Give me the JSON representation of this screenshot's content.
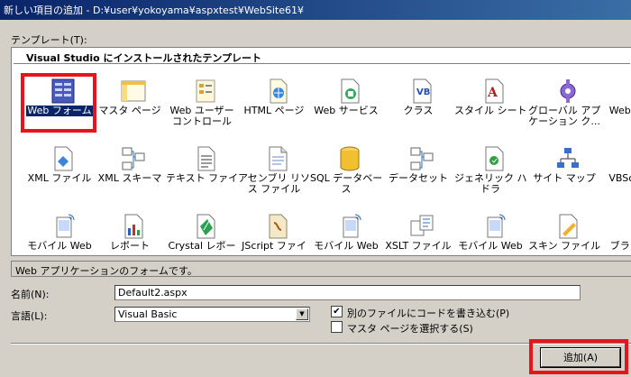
{
  "window": {
    "title": "新しい項目の追加 - D:¥user¥yokoyama¥aspxtest¥WebSite61¥"
  },
  "templates_label": "テンプレート(T):",
  "group_header": "Visual Studio にインストールされたテンプレート",
  "items": [
    {
      "l1": "Web フォーム",
      "l2": "",
      "icon": "web-form-icon"
    },
    {
      "l1": "マスタ ページ",
      "l2": "",
      "icon": "master-page-icon"
    },
    {
      "l1": "Web ユーザー",
      "l2": "コントロール",
      "icon": "web-user-control-icon"
    },
    {
      "l1": "HTML ページ",
      "l2": "",
      "icon": "html-page-icon"
    },
    {
      "l1": "Web サービス",
      "l2": "",
      "icon": "web-service-icon"
    },
    {
      "l1": "クラス",
      "l2": "",
      "icon": "class-icon"
    },
    {
      "l1": "スタイル シート",
      "l2": "",
      "icon": "style-sheet-icon"
    },
    {
      "l1": "グローバル アプリ",
      "l2": "ケーション ク...",
      "icon": "global-application-icon"
    },
    {
      "l1": "Web 構成フ",
      "l2": "ル",
      "icon": "web-config-icon"
    },
    {
      "l1": "XML ファイル",
      "l2": "",
      "icon": "xml-file-icon"
    },
    {
      "l1": "XML スキーマ",
      "l2": "",
      "icon": "xml-schema-icon"
    },
    {
      "l1": "テキスト ファイル",
      "l2": "",
      "icon": "text-file-icon"
    },
    {
      "l1": "アセンブリ リソー",
      "l2": "ス ファイル",
      "icon": "assembly-resource-icon"
    },
    {
      "l1": "SQL データベー",
      "l2": "ス",
      "icon": "sql-database-icon"
    },
    {
      "l1": "データセット",
      "l2": "",
      "icon": "dataset-icon"
    },
    {
      "l1": "ジェネリック ハン",
      "l2": "ドラ",
      "icon": "generic-handler-icon"
    },
    {
      "l1": "サイト マップ",
      "l2": "",
      "icon": "site-map-icon"
    },
    {
      "l1": "VBScript フ",
      "l2": "",
      "icon": "vbscript-file-icon"
    },
    {
      "l1": "モバイル Web",
      "l2": "",
      "icon": "mobile-web-form-icon"
    },
    {
      "l1": "レポート",
      "l2": "",
      "icon": "report-icon"
    },
    {
      "l1": "Crystal レポー",
      "l2": "",
      "icon": "crystal-report-icon"
    },
    {
      "l1": "JScript ファイ",
      "l2": "",
      "icon": "jscript-file-icon"
    },
    {
      "l1": "モバイル Web",
      "l2": "",
      "icon": "mobile-web-user-control-icon"
    },
    {
      "l1": "XSLT ファイル",
      "l2": "",
      "icon": "xslt-file-icon"
    },
    {
      "l1": "モバイル Web",
      "l2": "",
      "icon": "mobile-web-config-icon"
    },
    {
      "l1": "スキン ファイル",
      "l2": "",
      "icon": "skin-file-icon"
    },
    {
      "l1": "ブラウザ フ",
      "l2": "",
      "icon": "browser-file-icon"
    }
  ],
  "description": "Web アプリケーションのフォームです。",
  "name": {
    "label": "名前(N):",
    "value": "Default2.aspx"
  },
  "language": {
    "label": "言語(L):",
    "value": "Visual Basic"
  },
  "separate_code": {
    "label": "別のファイルにコードを書き込む(P)",
    "checked": true
  },
  "select_master": {
    "label": "マスタ ページを選択する(S)",
    "checked": false
  },
  "add_button": "追加(A)",
  "colors": {
    "highlight": "#e8141c",
    "selection": "#0a246a"
  }
}
